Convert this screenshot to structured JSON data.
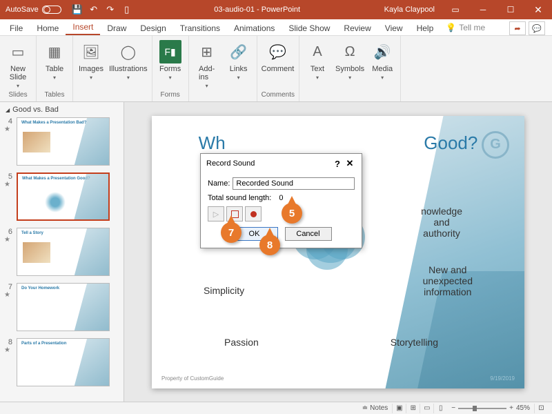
{
  "titlebar": {
    "autosave": "AutoSave",
    "title": "03-audio-01 - PowerPoint",
    "user": "Kayla Claypool"
  },
  "tabs": {
    "file": "File",
    "home": "Home",
    "insert": "Insert",
    "draw": "Draw",
    "design": "Design",
    "transitions": "Transitions",
    "animations": "Animations",
    "slideshow": "Slide Show",
    "review": "Review",
    "view": "View",
    "help": "Help",
    "tellme": "Tell me"
  },
  "ribbon": {
    "new_slide": "New\nSlide",
    "table": "Table",
    "images": "Images",
    "illustrations": "Illustrations",
    "forms": "Forms",
    "addins": "Add-\nins",
    "links": "Links",
    "comment": "Comment",
    "text": "Text",
    "symbols": "Symbols",
    "media": "Media",
    "g_slides": "Slides",
    "g_tables": "Tables",
    "g_forms": "Forms",
    "g_comments": "Comments"
  },
  "thumbnails": {
    "section": "Good vs. Bad",
    "items": [
      {
        "num": "4",
        "title": "What Makes a Presentation Bad?"
      },
      {
        "num": "5",
        "title": "What Makes a Presentation Good?"
      },
      {
        "num": "6",
        "title": "Tell a Story"
      },
      {
        "num": "7",
        "title": "Do Your Homework"
      },
      {
        "num": "8",
        "title": "Parts of a Presentation"
      }
    ]
  },
  "slide": {
    "title_full": "What Makes a Presentation Good?",
    "title_left": "Wh",
    "title_right": " Good?",
    "logo": "G",
    "labels": {
      "knowledge": "nowledge\nand\nauthority",
      "new_info": "New and\nunexpected\ninformation",
      "simplicity": "Simplicity",
      "passion": "Passion",
      "storytelling": "Storytelling"
    },
    "footer": "Property of CustomGuide",
    "date": "9/19/2019"
  },
  "dialog": {
    "title": "Record Sound",
    "name_label": "Name:",
    "name_value": "Recorded Sound",
    "length_label": "Total sound length:",
    "length_value": "0",
    "ok": "OK",
    "cancel": "Cancel"
  },
  "callouts": {
    "c5": "5",
    "c7": "7",
    "c8": "8"
  },
  "statusbar": {
    "notes": "Notes",
    "zoom": "45%"
  }
}
